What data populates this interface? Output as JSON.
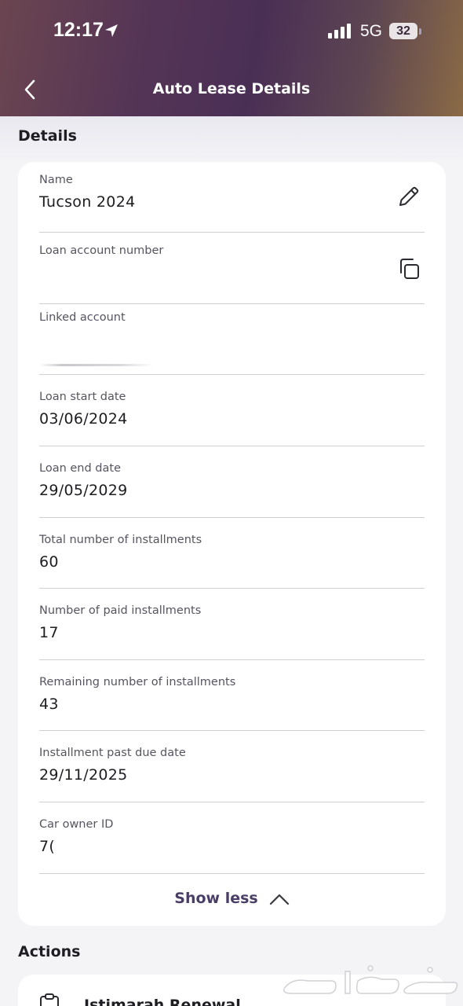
{
  "status_bar": {
    "time": "12:17",
    "network": "5G",
    "battery": "32"
  },
  "header": {
    "title": "Auto Lease Details"
  },
  "details": {
    "section_title": "Details",
    "rows": [
      {
        "label": "Name",
        "value": "Tucson 2024"
      },
      {
        "label": "Loan account number",
        "value": ""
      },
      {
        "label": "Linked account",
        "value": ""
      },
      {
        "label": "Loan start date",
        "value": "03/06/2024"
      },
      {
        "label": "Loan end date",
        "value": "29/05/2029"
      },
      {
        "label": "Total number of installments",
        "value": "60"
      },
      {
        "label": "Number of paid installments",
        "value": "17"
      },
      {
        "label": "Remaining number of installments",
        "value": "43"
      },
      {
        "label": "Installment past due date",
        "value": "29/11/2025"
      },
      {
        "label": "Car owner ID",
        "value": "7("
      }
    ],
    "show_less_label": "Show less"
  },
  "actions": {
    "section_title": "Actions",
    "items": [
      {
        "label": "Istimarah Renewal",
        "icon": "clipboard-icon"
      }
    ]
  },
  "colors": {
    "header_gradient_start": "#6b4550",
    "header_gradient_end": "#8a6a45",
    "accent": "#4b3e66"
  }
}
